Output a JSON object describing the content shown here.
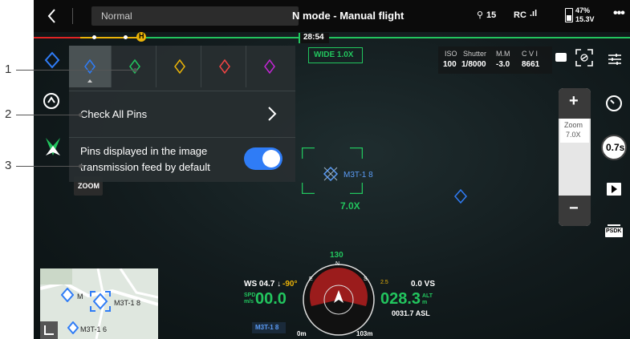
{
  "callouts": [
    "1",
    "2",
    "3"
  ],
  "topbar": {
    "back_icon": "chevron-left-icon",
    "mode_label": "Normal",
    "title": "N mode - Manual flight",
    "satellites": "15",
    "rc_label": "RC",
    "battery_percent": "47%",
    "battery_voltage": "15.3V",
    "more_icon": "more-icon"
  },
  "timeline": {
    "marker_label": "H",
    "time": "28:54"
  },
  "camera": {
    "lens_label": "WIDE 1.0X",
    "iso_label": "ISO",
    "iso_value": "100",
    "shutter_label": "Shutter",
    "shutter_value": "1/8000",
    "ev_label": "M.M",
    "ev_value": "-3.0",
    "cvi_label": "C V I",
    "cvi_value": "8661",
    "zoom_label": "Zoom",
    "zoom_value": "7.0X",
    "zoom_plus": "+",
    "zoom_minus": "−",
    "shutter_speed_badge": "0.7s",
    "psdk_label": "PSDK",
    "zoom_button": "ZOOM"
  },
  "target": {
    "label": "M3T-1 8",
    "zoom": "7.0X"
  },
  "pins_panel": {
    "pin_colors": [
      "#2f7cf6",
      "#22c55e",
      "#eab308",
      "#ef4444",
      "#c026d3"
    ],
    "check_all_label": "Check All Pins",
    "toggle_label_line1": "Pins displayed in the image",
    "toggle_label_line2": "transmission feed by default",
    "toggle_on": true
  },
  "flight": {
    "heading": "130",
    "wind": "WS 04.7 ↓",
    "wind_angle": "-90°",
    "spd_label": "SPD\nm/s",
    "spd_value": "00.0",
    "alt_value": "028.3",
    "alt_label": "ALT\nm",
    "vs_value": "0.0 VS",
    "vs_small": "2.5",
    "asl": "0031.7 ASL",
    "pin_name": "M3T-1 8",
    "dist_0": "0m",
    "dist_1": "103m"
  },
  "minimap": {
    "pin_a": "M3T-1 8",
    "pin_b": "M3T-1 6",
    "pin_c": "M"
  }
}
